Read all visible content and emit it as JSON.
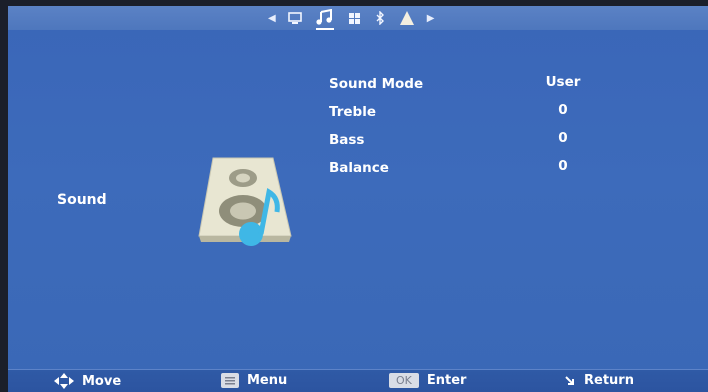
{
  "topbar": {
    "tabs": [
      {
        "icon": "left-arrow-icon"
      },
      {
        "icon": "picture-icon"
      },
      {
        "icon": "music-note-icon",
        "active": true
      },
      {
        "icon": "grid-icon"
      },
      {
        "icon": "bluetooth-icon"
      },
      {
        "icon": "lock-icon"
      },
      {
        "icon": "right-arrow-icon"
      }
    ]
  },
  "section": {
    "label": "Sound",
    "icon": "speaker-icon"
  },
  "menu": {
    "items": [
      {
        "label": "Sound Mode",
        "value": "User"
      },
      {
        "label": "Treble",
        "value": "0"
      },
      {
        "label": "Bass",
        "value": "0"
      },
      {
        "label": "Balance",
        "value": "0"
      }
    ]
  },
  "footer": {
    "move": "Move",
    "menu": "Menu",
    "ok_key": "OK",
    "enter": "Enter",
    "return": "Return"
  },
  "colors": {
    "background": "#3a66b8",
    "topbar": "#5b82c5",
    "footer": "#2f5aa6",
    "text": "#ffffff"
  }
}
